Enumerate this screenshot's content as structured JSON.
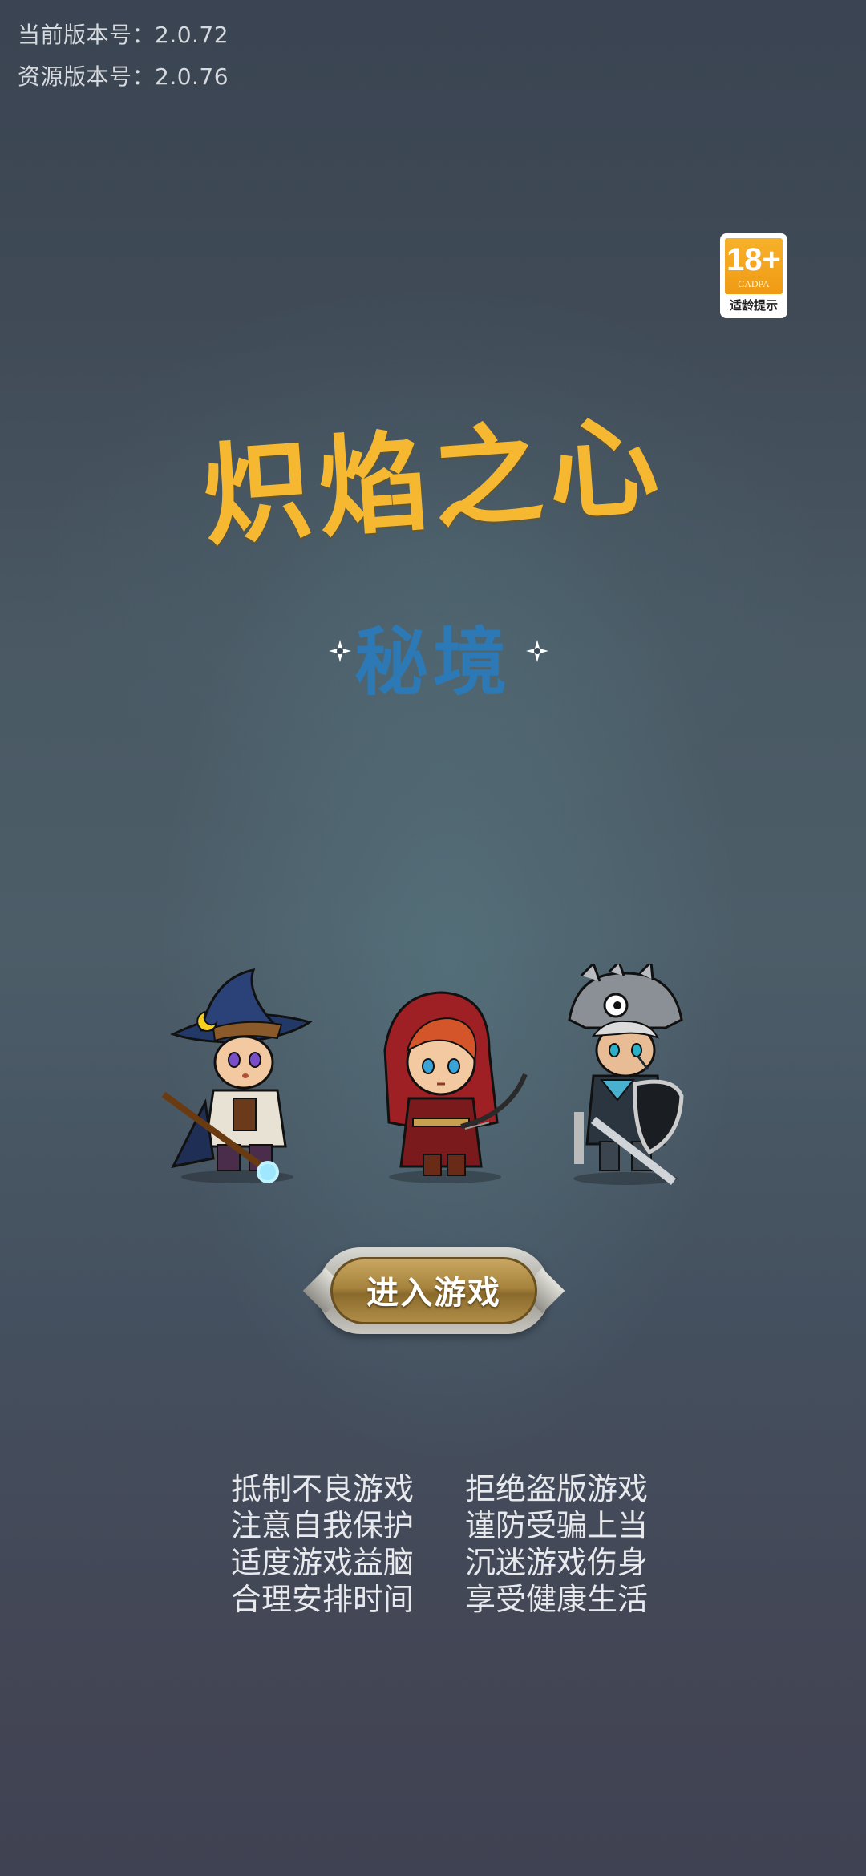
{
  "version": {
    "app": "当前版本号：2.0.72",
    "resource": "资源版本号：2.0.76"
  },
  "age_rating": {
    "number": "18+",
    "org": "CADPA",
    "hint": "适龄提示"
  },
  "title": "炽焰之心",
  "subtitle": "秘境",
  "enter_button": {
    "label": "进入游戏"
  },
  "health_notice": {
    "rows": [
      [
        "抵制不良游戏",
        "拒绝盗版游戏"
      ],
      [
        "注意自我保护",
        "谨防受骗上当"
      ],
      [
        "适度游戏益脑",
        "沉迷游戏伤身"
      ],
      [
        "合理安排时间",
        "享受健康生活"
      ]
    ]
  },
  "colors": {
    "title": "#f5b830",
    "subtitle": "#2c79b5",
    "badge": "#f09a14"
  },
  "icons": [
    "wizard-character",
    "archer-character",
    "knight-character",
    "sparkle-icon"
  ]
}
